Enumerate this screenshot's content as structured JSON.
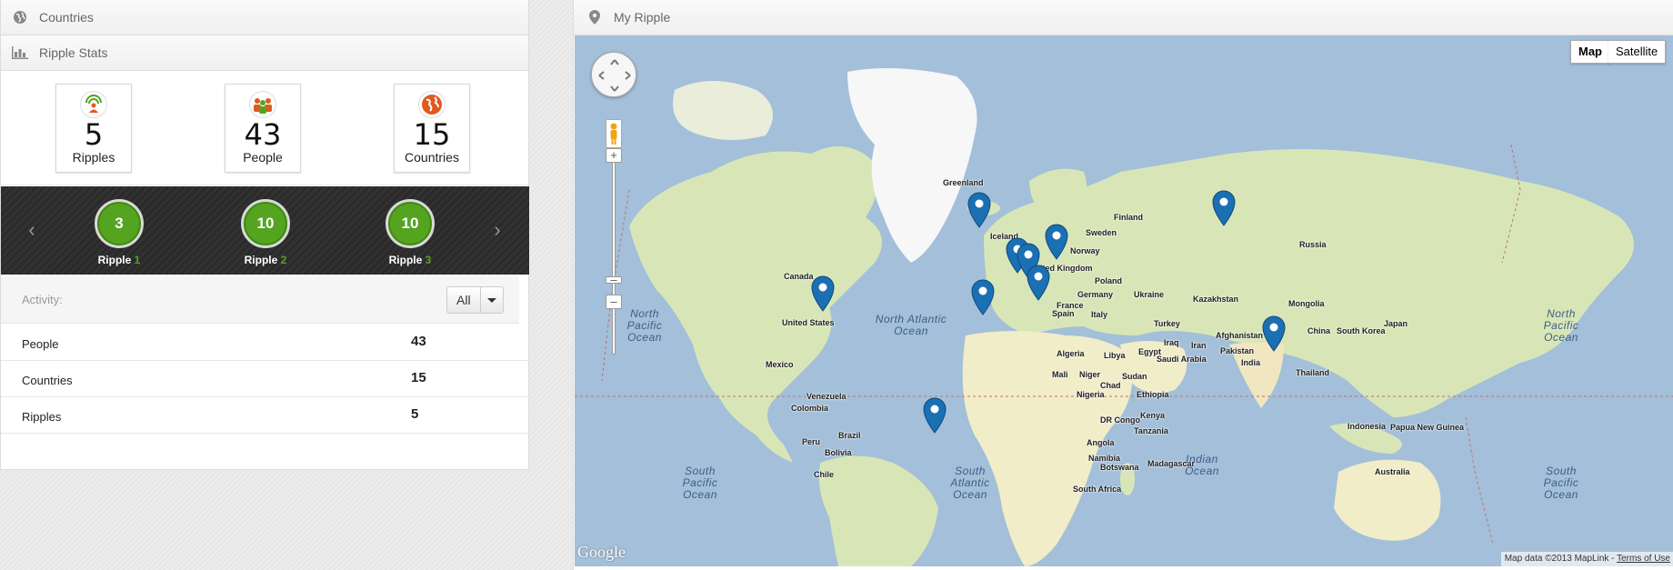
{
  "countries_panel": {
    "title": "Countries",
    "icon": "globe-icon"
  },
  "stats_panel": {
    "title": "Ripple Stats",
    "icon": "bar-chart-icon"
  },
  "stat_cards": [
    {
      "value": "5",
      "label": "Ripples",
      "icon": "ripple-icon"
    },
    {
      "value": "43",
      "label": "People",
      "icon": "people-icon"
    },
    {
      "value": "15",
      "label": "Countries",
      "icon": "globe-orange-icon"
    }
  ],
  "ripples": [
    {
      "count": "3",
      "label": "Ripple",
      "number": "1"
    },
    {
      "count": "10",
      "label": "Ripple",
      "number": "2"
    },
    {
      "count": "10",
      "label": "Ripple",
      "number": "3"
    }
  ],
  "activity": {
    "label": "Activity:",
    "filter": "All"
  },
  "table": [
    {
      "key": "People",
      "value": "43"
    },
    {
      "key": "Countries",
      "value": "15"
    },
    {
      "key": "Ripples",
      "value": "5"
    }
  ],
  "map_panel": {
    "title": "My Ripple",
    "icon": "map-pin-icon"
  },
  "map": {
    "type_buttons": [
      "Map",
      "Satellite"
    ],
    "logo": "Google",
    "attribution": "Map data ©2013 MapLink - ",
    "terms": "Terms of Use",
    "labels": [
      "Greenland",
      "Iceland",
      "Finland",
      "Sweden",
      "Norway",
      "Russia",
      "United Kingdom",
      "Poland",
      "Germany",
      "Ukraine",
      "France",
      "Italy",
      "Kazakhstan",
      "Mongolia",
      "Canada",
      "United States",
      "Turkey",
      "Afghanistan",
      "China",
      "Japan",
      "South Korea",
      "Iraq",
      "Iran",
      "Pakistan",
      "Mexico",
      "Algeria",
      "Libya",
      "Egypt",
      "Saudi Arabia",
      "India",
      "Thailand",
      "Mali",
      "Niger",
      "Sudan",
      "Chad",
      "Nigeria",
      "Ethiopia",
      "Venezuela",
      "Colombia",
      "DR Congo",
      "Kenya",
      "Tanzania",
      "Indonesia",
      "Papua New Guinea",
      "Peru",
      "Brazil",
      "Bolivia",
      "Angola",
      "Namibia",
      "Botswana",
      "Madagascar",
      "Chile",
      "Australia",
      "South Africa",
      "Spain"
    ],
    "oceans": [
      "North Pacific Ocean",
      "North Atlantic Ocean",
      "North Pacific Ocean",
      "South Pacific Ocean",
      "South Atlantic Ocean",
      "Indian Ocean",
      "South Pacific Ocean"
    ]
  },
  "colors": {
    "accent_green": "#54a420",
    "band": "#2f2f2f",
    "ocean": "#a3bfd9",
    "pin": "#1b6fb3"
  }
}
